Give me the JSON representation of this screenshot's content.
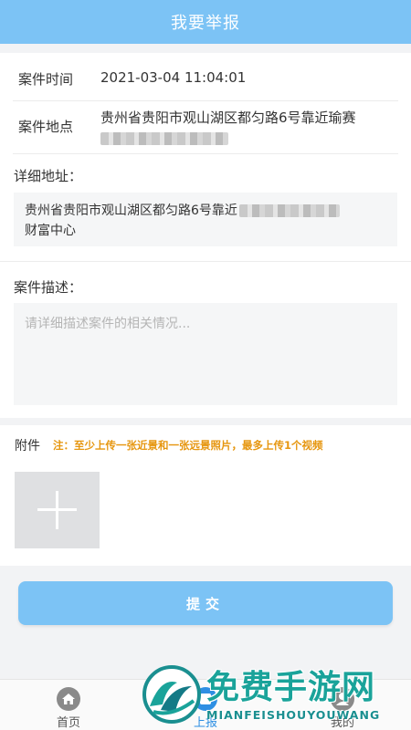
{
  "header": {
    "title": "我要举报"
  },
  "form": {
    "case_time_label": "案件时间",
    "case_time_value": "2021-03-04 11:04:01",
    "case_location_label": "案件地点",
    "case_location_value": "贵州省贵阳市观山湖区都匀路6号靠近瑜赛",
    "detail_address_label": "详细地址：",
    "detail_address_value_line1": "贵州省贵阳市观山湖区都匀路6号靠近",
    "detail_address_value_line2": "财富中心",
    "description_label": "案件描述：",
    "description_placeholder": "请详细描述案件的相关情况..."
  },
  "attachments": {
    "label": "附件",
    "note": "注：至少上传一张近景和一张远景照片，最多上传1个视频",
    "add_icon": "plus-icon"
  },
  "submit": {
    "label": "提交"
  },
  "tabbar": {
    "items": [
      {
        "label": "首页",
        "icon": "home-icon",
        "active": false
      },
      {
        "label": "上报",
        "icon": "report-icon",
        "active": true
      },
      {
        "label": "我的",
        "icon": "user-icon",
        "active": false
      }
    ]
  },
  "watermark": {
    "title": "免费手游网",
    "subtitle": "MIANFEISHOUYOUWANG"
  },
  "colors": {
    "primary": "#7cc3f5",
    "accent_note": "#e6960f",
    "active_tab": "#2e8fe3",
    "watermark": "#1aa39a"
  }
}
